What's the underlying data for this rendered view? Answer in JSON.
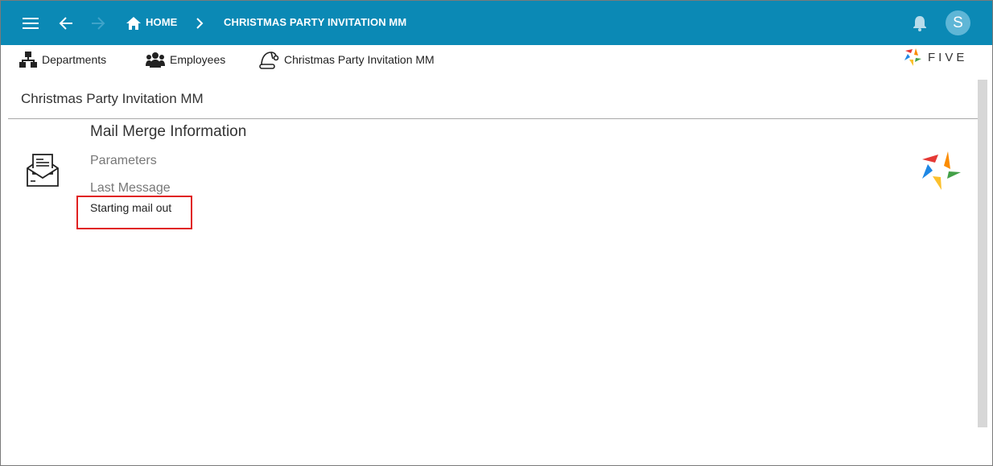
{
  "header": {
    "breadcrumb_home": "HOME",
    "breadcrumb_current": "CHRISTMAS PARTY INVITATION MM",
    "avatar_initial": "S",
    "color": "#0b89b5",
    "icons": [
      "menu-icon",
      "back-arrow-icon",
      "forward-arrow-icon",
      "home-icon",
      "chevron-right-icon",
      "bell-icon"
    ]
  },
  "menu": {
    "items": [
      {
        "label": "Departments",
        "icon": "org-chart-icon"
      },
      {
        "label": "Employees",
        "icon": "users-icon"
      },
      {
        "label": "Christmas Party Invitation MM",
        "icon": "santa-hat-icon"
      }
    ]
  },
  "brand": {
    "name": "FIVE"
  },
  "page": {
    "title": "Christmas Party Invitation MM",
    "section_title": "Mail Merge Information",
    "parameters_label": "Parameters",
    "last_message_label": "Last Message",
    "last_message_value": "Starting mail out",
    "highlight_color": "#e02020"
  }
}
